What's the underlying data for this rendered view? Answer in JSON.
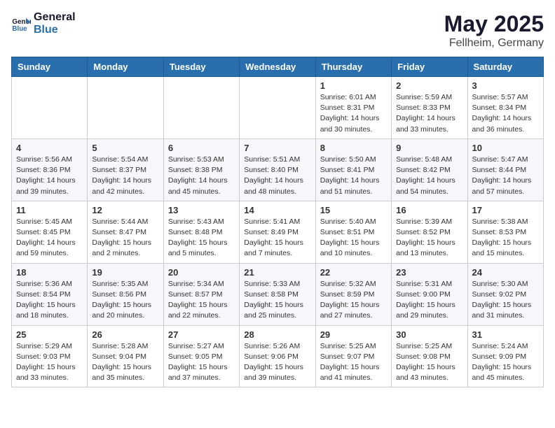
{
  "header": {
    "logo_general": "General",
    "logo_blue": "Blue",
    "month_year": "May 2025",
    "location": "Fellheim, Germany"
  },
  "weekdays": [
    "Sunday",
    "Monday",
    "Tuesday",
    "Wednesday",
    "Thursday",
    "Friday",
    "Saturday"
  ],
  "weeks": [
    [
      {
        "day": "",
        "info": ""
      },
      {
        "day": "",
        "info": ""
      },
      {
        "day": "",
        "info": ""
      },
      {
        "day": "",
        "info": ""
      },
      {
        "day": "1",
        "info": "Sunrise: 6:01 AM\nSunset: 8:31 PM\nDaylight: 14 hours\nand 30 minutes."
      },
      {
        "day": "2",
        "info": "Sunrise: 5:59 AM\nSunset: 8:33 PM\nDaylight: 14 hours\nand 33 minutes."
      },
      {
        "day": "3",
        "info": "Sunrise: 5:57 AM\nSunset: 8:34 PM\nDaylight: 14 hours\nand 36 minutes."
      }
    ],
    [
      {
        "day": "4",
        "info": "Sunrise: 5:56 AM\nSunset: 8:36 PM\nDaylight: 14 hours\nand 39 minutes."
      },
      {
        "day": "5",
        "info": "Sunrise: 5:54 AM\nSunset: 8:37 PM\nDaylight: 14 hours\nand 42 minutes."
      },
      {
        "day": "6",
        "info": "Sunrise: 5:53 AM\nSunset: 8:38 PM\nDaylight: 14 hours\nand 45 minutes."
      },
      {
        "day": "7",
        "info": "Sunrise: 5:51 AM\nSunset: 8:40 PM\nDaylight: 14 hours\nand 48 minutes."
      },
      {
        "day": "8",
        "info": "Sunrise: 5:50 AM\nSunset: 8:41 PM\nDaylight: 14 hours\nand 51 minutes."
      },
      {
        "day": "9",
        "info": "Sunrise: 5:48 AM\nSunset: 8:42 PM\nDaylight: 14 hours\nand 54 minutes."
      },
      {
        "day": "10",
        "info": "Sunrise: 5:47 AM\nSunset: 8:44 PM\nDaylight: 14 hours\nand 57 minutes."
      }
    ],
    [
      {
        "day": "11",
        "info": "Sunrise: 5:45 AM\nSunset: 8:45 PM\nDaylight: 14 hours\nand 59 minutes."
      },
      {
        "day": "12",
        "info": "Sunrise: 5:44 AM\nSunset: 8:47 PM\nDaylight: 15 hours\nand 2 minutes."
      },
      {
        "day": "13",
        "info": "Sunrise: 5:43 AM\nSunset: 8:48 PM\nDaylight: 15 hours\nand 5 minutes."
      },
      {
        "day": "14",
        "info": "Sunrise: 5:41 AM\nSunset: 8:49 PM\nDaylight: 15 hours\nand 7 minutes."
      },
      {
        "day": "15",
        "info": "Sunrise: 5:40 AM\nSunset: 8:51 PM\nDaylight: 15 hours\nand 10 minutes."
      },
      {
        "day": "16",
        "info": "Sunrise: 5:39 AM\nSunset: 8:52 PM\nDaylight: 15 hours\nand 13 minutes."
      },
      {
        "day": "17",
        "info": "Sunrise: 5:38 AM\nSunset: 8:53 PM\nDaylight: 15 hours\nand 15 minutes."
      }
    ],
    [
      {
        "day": "18",
        "info": "Sunrise: 5:36 AM\nSunset: 8:54 PM\nDaylight: 15 hours\nand 18 minutes."
      },
      {
        "day": "19",
        "info": "Sunrise: 5:35 AM\nSunset: 8:56 PM\nDaylight: 15 hours\nand 20 minutes."
      },
      {
        "day": "20",
        "info": "Sunrise: 5:34 AM\nSunset: 8:57 PM\nDaylight: 15 hours\nand 22 minutes."
      },
      {
        "day": "21",
        "info": "Sunrise: 5:33 AM\nSunset: 8:58 PM\nDaylight: 15 hours\nand 25 minutes."
      },
      {
        "day": "22",
        "info": "Sunrise: 5:32 AM\nSunset: 8:59 PM\nDaylight: 15 hours\nand 27 minutes."
      },
      {
        "day": "23",
        "info": "Sunrise: 5:31 AM\nSunset: 9:00 PM\nDaylight: 15 hours\nand 29 minutes."
      },
      {
        "day": "24",
        "info": "Sunrise: 5:30 AM\nSunset: 9:02 PM\nDaylight: 15 hours\nand 31 minutes."
      }
    ],
    [
      {
        "day": "25",
        "info": "Sunrise: 5:29 AM\nSunset: 9:03 PM\nDaylight: 15 hours\nand 33 minutes."
      },
      {
        "day": "26",
        "info": "Sunrise: 5:28 AM\nSunset: 9:04 PM\nDaylight: 15 hours\nand 35 minutes."
      },
      {
        "day": "27",
        "info": "Sunrise: 5:27 AM\nSunset: 9:05 PM\nDaylight: 15 hours\nand 37 minutes."
      },
      {
        "day": "28",
        "info": "Sunrise: 5:26 AM\nSunset: 9:06 PM\nDaylight: 15 hours\nand 39 minutes."
      },
      {
        "day": "29",
        "info": "Sunrise: 5:25 AM\nSunset: 9:07 PM\nDaylight: 15 hours\nand 41 minutes."
      },
      {
        "day": "30",
        "info": "Sunrise: 5:25 AM\nSunset: 9:08 PM\nDaylight: 15 hours\nand 43 minutes."
      },
      {
        "day": "31",
        "info": "Sunrise: 5:24 AM\nSunset: 9:09 PM\nDaylight: 15 hours\nand 45 minutes."
      }
    ]
  ]
}
